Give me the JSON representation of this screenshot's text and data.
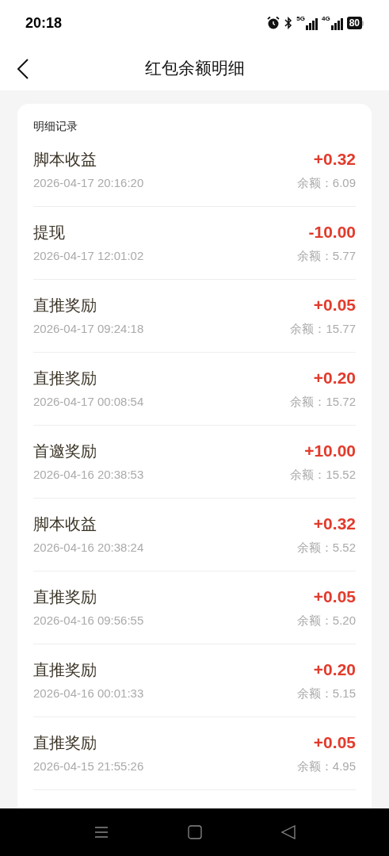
{
  "status_bar": {
    "time": "20:18",
    "network_1": "5G",
    "network_2": "4G",
    "battery": "80"
  },
  "header": {
    "title": "红包余额明细"
  },
  "section": {
    "title": "明细记录"
  },
  "records": [
    {
      "title": "脚本收益",
      "time": "2026-04-17 20:16:20",
      "amount": "+0.32",
      "balance": "余额：6.09"
    },
    {
      "title": "提现",
      "time": "2026-04-17 12:01:02",
      "amount": "-10.00",
      "balance": "余额：5.77"
    },
    {
      "title": "直推奖励",
      "time": "2026-04-17 09:24:18",
      "amount": "+0.05",
      "balance": "余额：15.77"
    },
    {
      "title": "直推奖励",
      "time": "2026-04-17 00:08:54",
      "amount": "+0.20",
      "balance": "余额：15.72"
    },
    {
      "title": "首邀奖励",
      "time": "2026-04-16 20:38:53",
      "amount": "+10.00",
      "balance": "余额：15.52"
    },
    {
      "title": "脚本收益",
      "time": "2026-04-16 20:38:24",
      "amount": "+0.32",
      "balance": "余额：5.52"
    },
    {
      "title": "直推奖励",
      "time": "2026-04-16 09:56:55",
      "amount": "+0.05",
      "balance": "余额：5.20"
    },
    {
      "title": "直推奖励",
      "time": "2026-04-16 00:01:33",
      "amount": "+0.20",
      "balance": "余额：5.15"
    },
    {
      "title": "直推奖励",
      "time": "2026-04-15 21:55:26",
      "amount": "+0.05",
      "balance": "余额：4.95"
    }
  ]
}
